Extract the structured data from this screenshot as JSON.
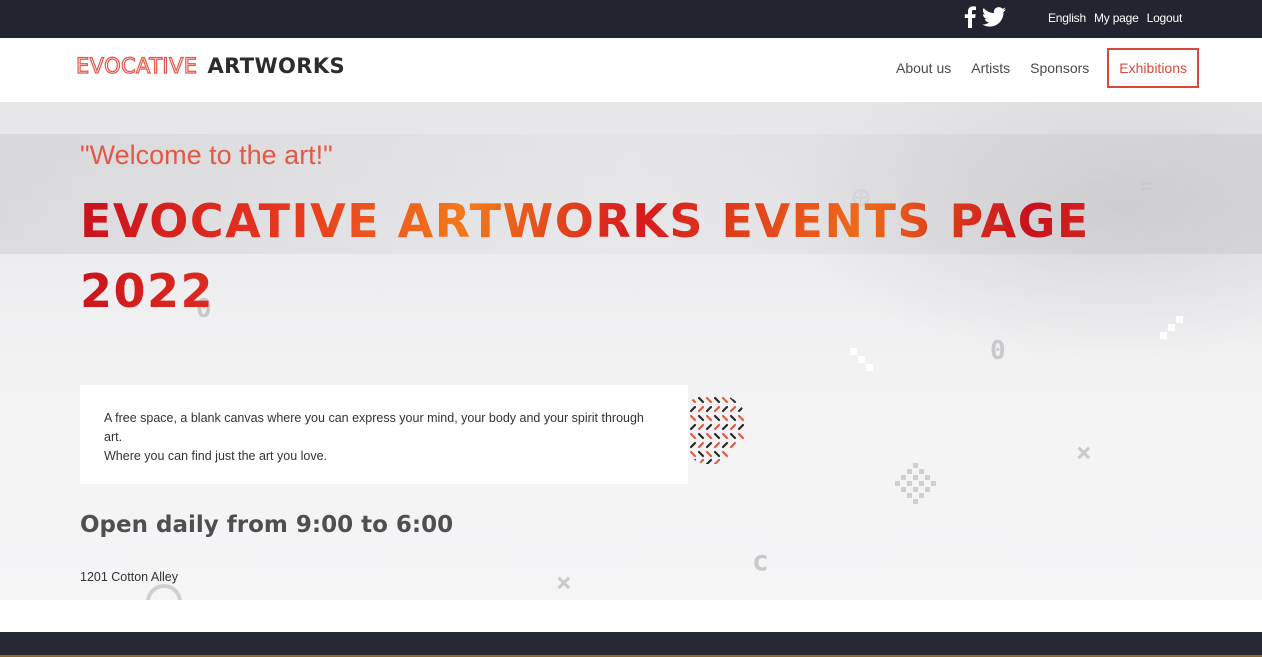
{
  "topbar": {
    "social": [
      {
        "icon": "facebook-icon"
      },
      {
        "icon": "twitter-icon"
      }
    ],
    "links": [
      "English",
      "My page",
      "Logout"
    ]
  },
  "header": {
    "logo": {
      "part1": "EVOCATIVE",
      "part2": "ARTWORKS"
    },
    "nav": [
      {
        "label": "About us",
        "active": false
      },
      {
        "label": "Artists",
        "active": false
      },
      {
        "label": "Sponsors",
        "active": false
      },
      {
        "label": "Exhibitions",
        "active": true
      }
    ]
  },
  "hero": {
    "welcome": "\"Welcome to the art!\"",
    "headline": "EVOCATIVE ARTWORKS EVENTS PAGE 2022",
    "description_line1": "A free space, a blank canvas where you can express your mind, your body and your spirit through art.",
    "description_line2": "Where you can find just the art you love.",
    "hours": "Open daily from 9:00 to 6:00",
    "address": "1201 Cotton Alley"
  },
  "colors": {
    "accent": "#e15a45",
    "nav_active": "#d9493a",
    "topbar": "#22252f",
    "footer": "#262833"
  }
}
